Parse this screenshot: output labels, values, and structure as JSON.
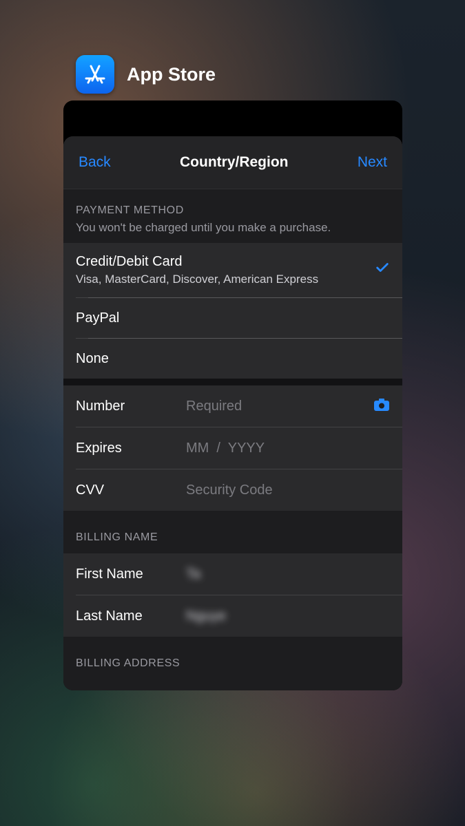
{
  "app": {
    "title": "App Store"
  },
  "nav": {
    "back": "Back",
    "title": "Country/Region",
    "next": "Next"
  },
  "payment_section": {
    "header": "PAYMENT METHOD",
    "sub": "You won't be charged until you make a purchase."
  },
  "methods": {
    "card": {
      "title": "Credit/Debit Card",
      "sub": "Visa, MasterCard, Discover, American Express",
      "selected": true
    },
    "paypal": {
      "title": "PayPal"
    },
    "none": {
      "title": "None"
    }
  },
  "card_form": {
    "number_label": "Number",
    "number_ph": "Required",
    "expires_label": "Expires",
    "expires_ph": "MM  /  YYYY",
    "cvv_label": "CVV",
    "cvv_ph": "Security Code"
  },
  "billing_name": {
    "header": "BILLING NAME",
    "first_label": "First Name",
    "first_value": "Ta",
    "last_label": "Last Name",
    "last_value": "Nguye"
  },
  "billing_address": {
    "header": "BILLING ADDRESS"
  }
}
